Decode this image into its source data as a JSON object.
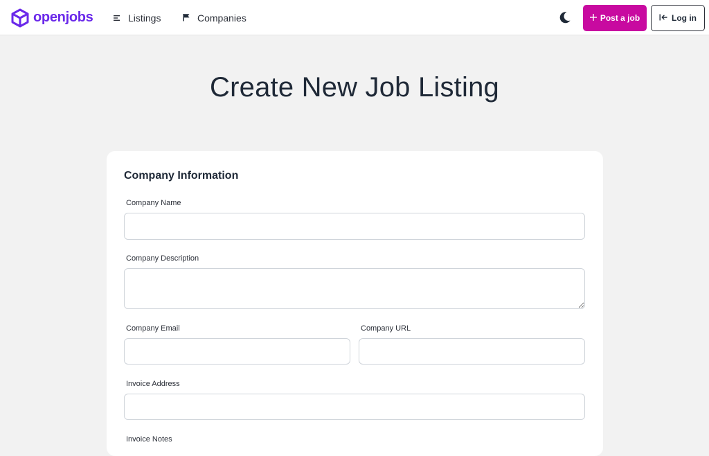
{
  "nav": {
    "logo_text": "openjobs",
    "listings_label": "Listings",
    "companies_label": "Companies",
    "post_job_label": "Post a job",
    "login_label": "Log in"
  },
  "page": {
    "title": "Create New Job Listing"
  },
  "form": {
    "section_title": "Company Information",
    "company_name_label": "Company Name",
    "company_name_value": "",
    "company_description_label": "Company Description",
    "company_description_value": "",
    "company_email_label": "Company Email",
    "company_email_value": "",
    "company_url_label": "Company URL",
    "company_url_value": "",
    "invoice_address_label": "Invoice Address",
    "invoice_address_value": "",
    "invoice_notes_label": "Invoice Notes"
  },
  "icons": {
    "logo": "cube-icon",
    "listings": "list-icon",
    "companies": "flag-icon",
    "theme": "moon-icon",
    "post": "plus-icon",
    "login": "login-icon"
  },
  "colors": {
    "brand": "#6a28ea",
    "accent": "#c80aa0",
    "background": "#f2f2f2"
  }
}
